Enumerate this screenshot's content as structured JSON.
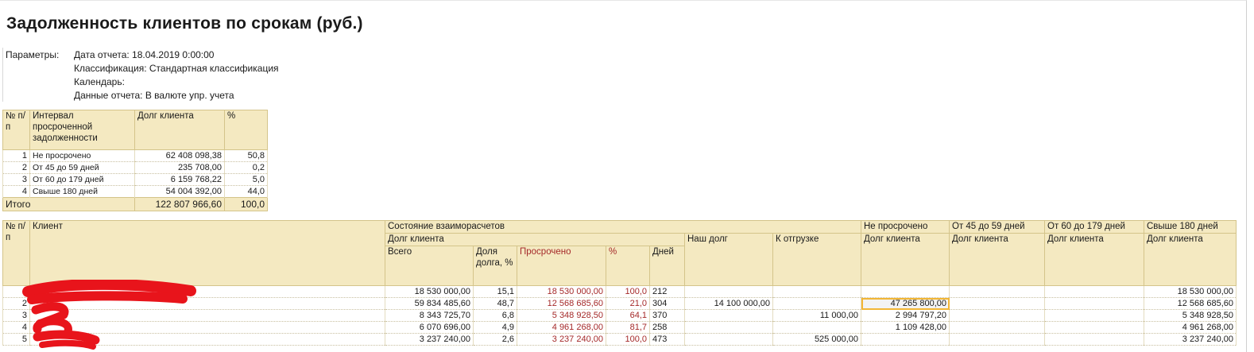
{
  "report": {
    "title": "Задолженность клиентов по срокам (руб.)",
    "params_label": "Параметры:",
    "params": [
      "Дата отчета: 18.04.2019 0:00:00",
      "Классификация: Стандартная классификация",
      "Календарь:",
      "Данные отчета: В валюте упр. учета"
    ]
  },
  "summary": {
    "headers": {
      "num": "№ п/п",
      "interval": "Интервал просроченной задолженности",
      "debt": "Долг клиента",
      "pct": "%"
    },
    "rows": [
      {
        "n": "1",
        "interval": "Не просрочено",
        "debt": "62 408 098,38",
        "pct": "50,8"
      },
      {
        "n": "2",
        "interval": "От 45 до 59 дней",
        "debt": "235 708,00",
        "pct": "0,2"
      },
      {
        "n": "3",
        "interval": "От 60 до 179 дней",
        "debt": "6 159 768,22",
        "pct": "5,0"
      },
      {
        "n": "4",
        "interval": "Свыше 180 дней",
        "debt": "54 004 392,00",
        "pct": "44,0"
      }
    ],
    "total": {
      "label": "Итого",
      "debt": "122 807 966,60",
      "pct": "100,0"
    }
  },
  "main": {
    "headers": {
      "num": "№ п/п",
      "client": "Клиент",
      "state": "Состояние взаиморасчетов",
      "client_debt": "Долг клиента",
      "total": "Всего",
      "share": "Доля долга, %",
      "overdue": "Просрочено",
      "overdue_pct": "%",
      "days": "Дней",
      "our_debt": "Наш долг",
      "to_ship": "К отгрузке",
      "not_overdue": "Не просрочено",
      "d45_59": "От 45 до 59 дней",
      "d60_179": "От 60 до 179 дней",
      "d180": "Свыше 180 дней",
      "debt_label": "Долг клиента"
    },
    "rows": [
      {
        "n": "1",
        "total": "18 530 000,00",
        "share": "15,1",
        "overdue": "18 530 000,00",
        "opct": "100,0",
        "days": "212",
        "our": "",
        "ship": "",
        "notov": "",
        "d45": "",
        "d60": "",
        "d180": "18 530 000,00"
      },
      {
        "n": "2",
        "total": "59 834 485,60",
        "share": "48,7",
        "overdue": "12 568 685,60",
        "opct": "21,0",
        "days": "304",
        "our": "14 100 000,00",
        "ship": "",
        "notov": "47 265 800,00",
        "d45": "",
        "d60": "",
        "d180": "12 568 685,60"
      },
      {
        "n": "3",
        "total": "8 343 725,70",
        "share": "6,8",
        "overdue": "5 348 928,50",
        "opct": "64,1",
        "days": "370",
        "our": "",
        "ship": "11 000,00",
        "notov": "2 994 797,20",
        "d45": "",
        "d60": "",
        "d180": "5 348 928,50"
      },
      {
        "n": "4",
        "total": "6 070 696,00",
        "share": "4,9",
        "overdue": "4 961 268,00",
        "opct": "81,7",
        "days": "258",
        "our": "",
        "ship": "",
        "notov": "1 109 428,00",
        "d45": "",
        "d60": "",
        "d180": "4 961 268,00"
      },
      {
        "n": "5",
        "total": "3 237 240,00",
        "share": "2,6",
        "overdue": "3 237 240,00",
        "opct": "100,0",
        "days": "473",
        "our": "",
        "ship": "525 000,00",
        "notov": "",
        "d45": "",
        "d60": "",
        "d180": "3 237 240,00"
      }
    ]
  },
  "colors": {
    "header_bg": "#f4e9c1",
    "overdue_text": "#a52a2a",
    "selection": "#f2b636",
    "redaction": "#e8141b"
  }
}
